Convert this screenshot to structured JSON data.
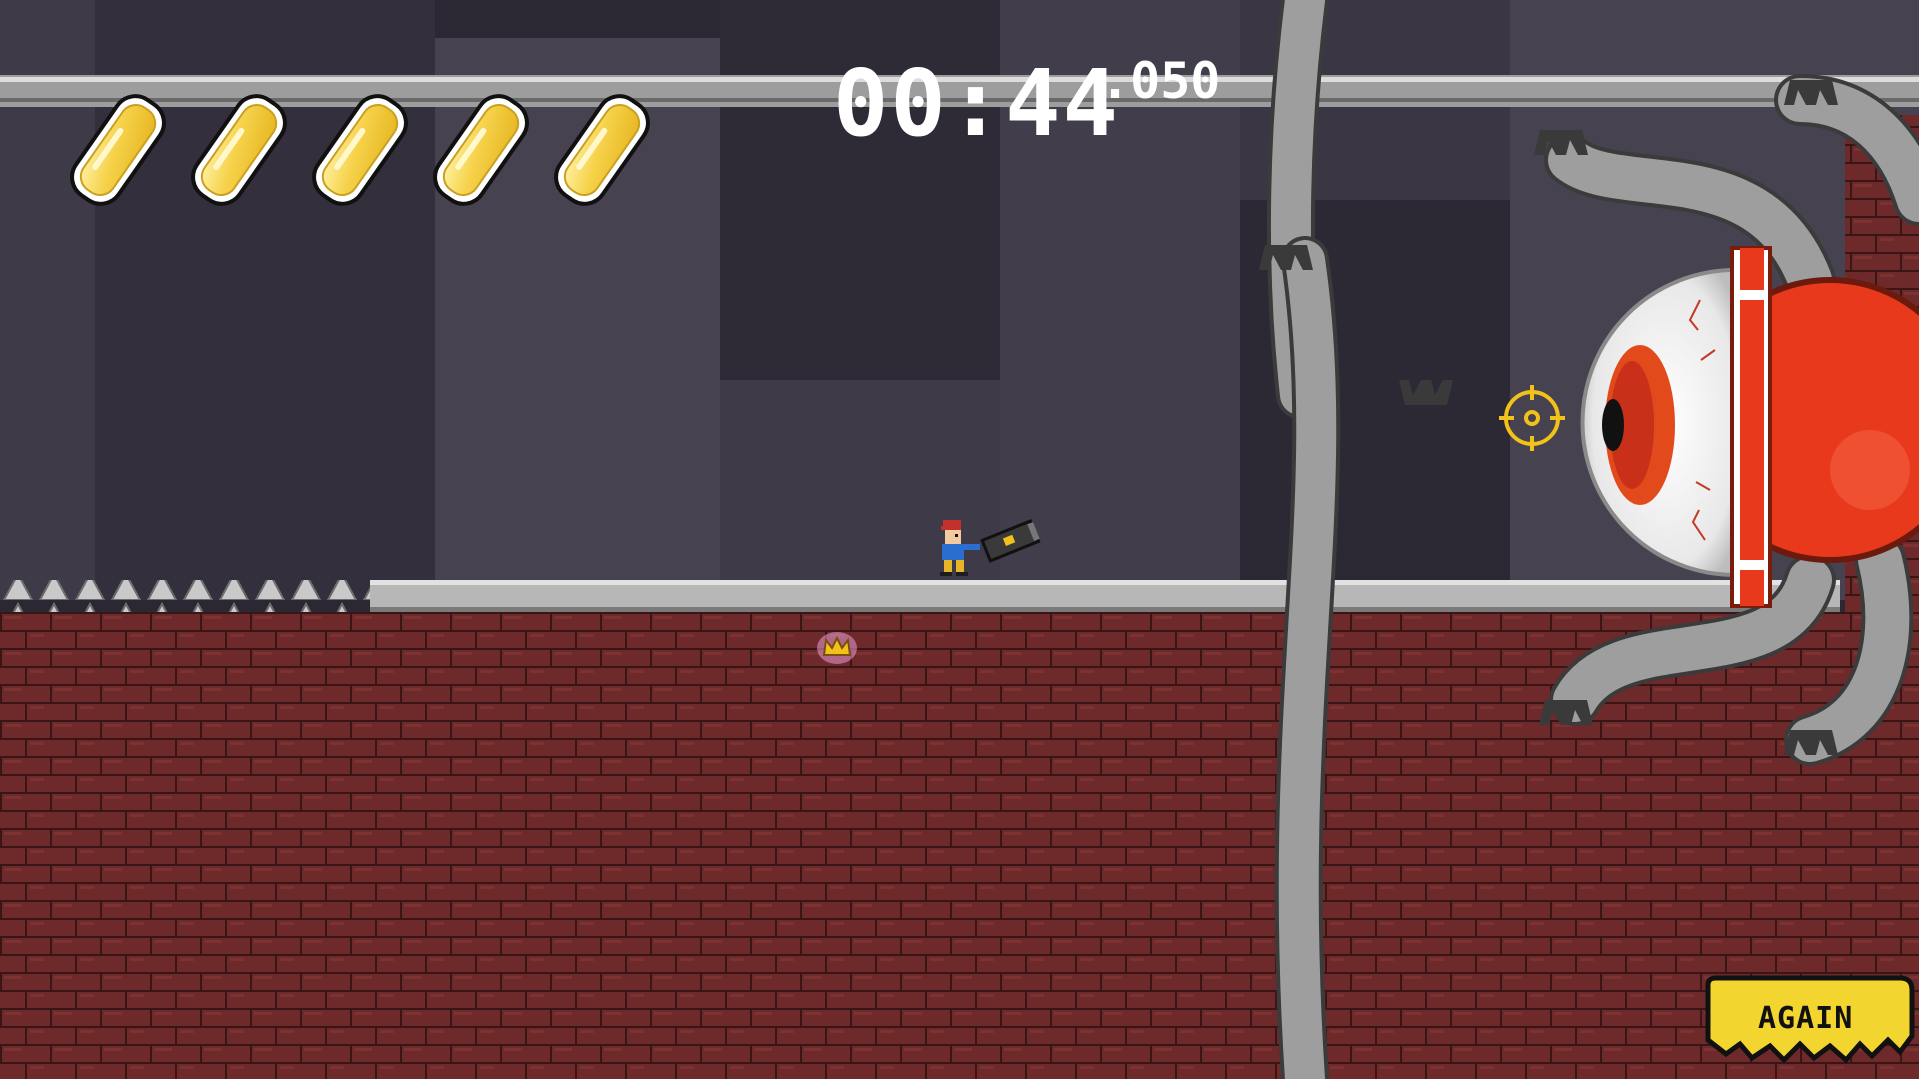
{
  "hud": {
    "timer_main": "00:44",
    "timer_ms": ".050",
    "health_cells": 5
  },
  "buttons": {
    "again_label": "AGAIN"
  },
  "colors": {
    "background": "#2b2834",
    "brick": "#6e2a2a",
    "platform": "#b7b7b7",
    "health_cell": "#f4cc3c",
    "boss_red": "#e8391c",
    "again_button": "#f2d52e",
    "crosshair": "#f2c21b"
  },
  "entities": {
    "player": "player-with-blaster",
    "boss": "mechanical-eyeball-boss",
    "pickup": "crown-icon",
    "hazard": "floor-spikes"
  }
}
